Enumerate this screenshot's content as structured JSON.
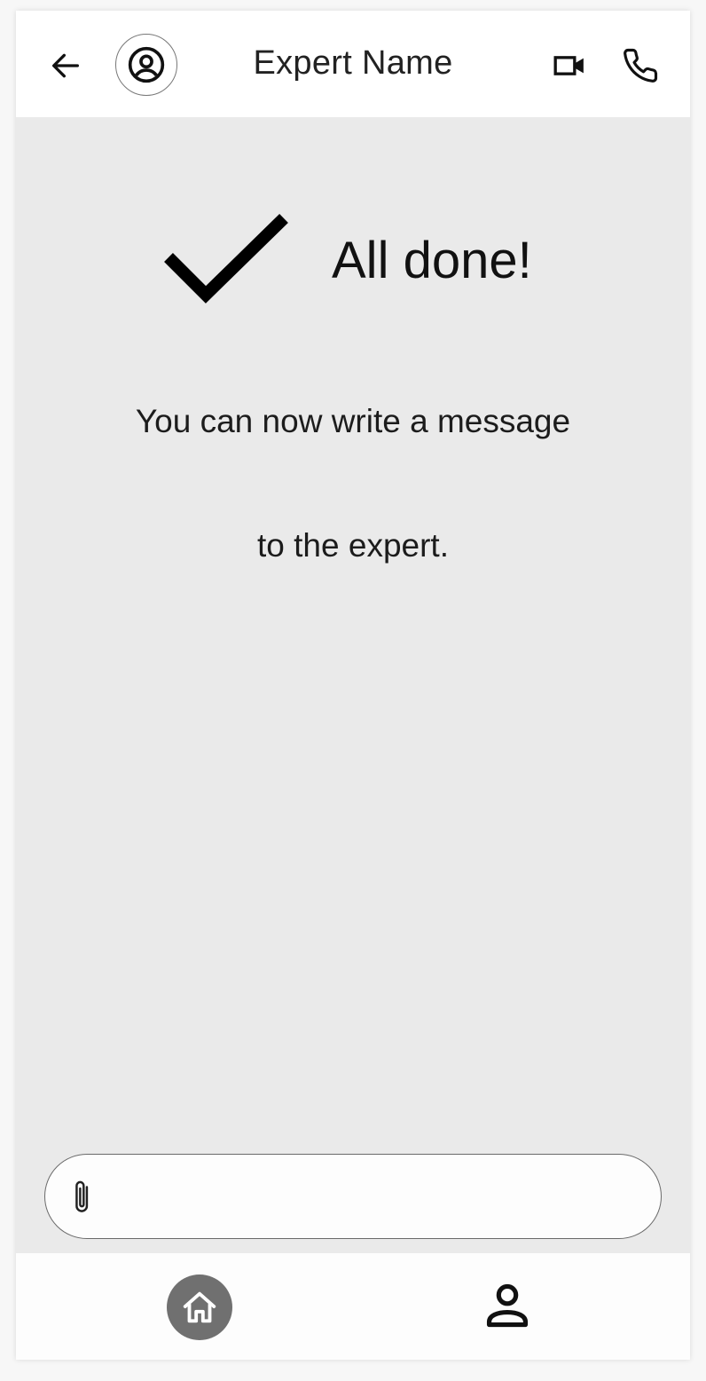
{
  "header": {
    "title": "Expert Name",
    "icons": {
      "back": "arrow-left-icon",
      "avatar": "user-circle-icon",
      "video": "video-camera-icon",
      "call": "phone-icon"
    }
  },
  "content": {
    "status_title": "All done!",
    "status_icon": "checkmark-icon",
    "message_line1": "You can now write a message",
    "message_line2": "to the expert."
  },
  "composer": {
    "value": "",
    "placeholder": "",
    "attach_icon": "paperclip-icon"
  },
  "bottom_nav": {
    "items": [
      {
        "icon": "home-icon",
        "active": true
      },
      {
        "icon": "user-icon",
        "active": false
      }
    ]
  },
  "colors": {
    "background": "#eaeaea",
    "header": "#ffffff",
    "active_nav": "#707070",
    "text": "#111111"
  }
}
